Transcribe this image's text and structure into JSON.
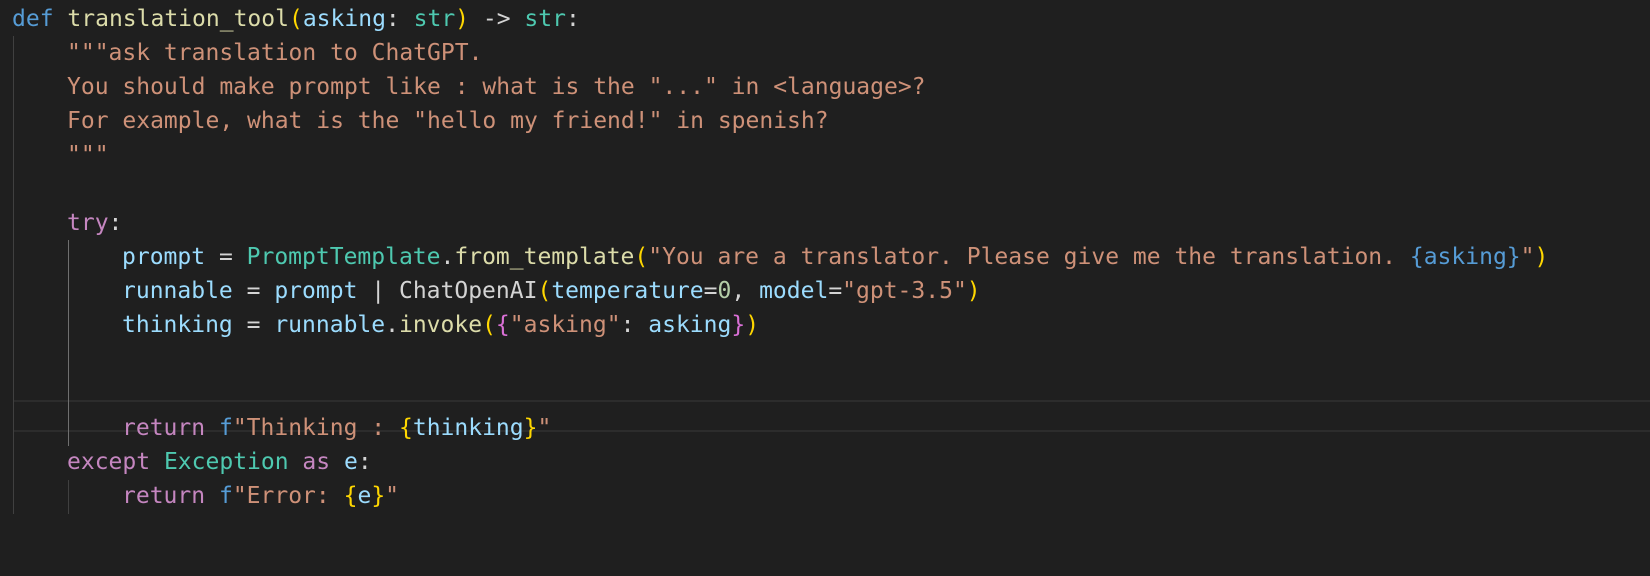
{
  "code": {
    "l1": {
      "def": "def",
      "name": "translation_tool",
      "open": "(",
      "param": "asking",
      "colon": ": ",
      "ptype": "str",
      "close": ")",
      "arrow": " -> ",
      "rtype": "str",
      "end": ":"
    },
    "l2": {
      "text": "\"\"\"ask translation to ChatGPT."
    },
    "l3": {
      "text": "You should make prompt like : what is the \"...\" in <language>?"
    },
    "l4": {
      "text": "For example, what is the \"hello my friend!\" in spenish?"
    },
    "l5": {
      "text": "\"\"\""
    },
    "l7": {
      "try": "try",
      "colon": ":"
    },
    "l8": {
      "var": "prompt",
      "eq": " = ",
      "cls": "PromptTemplate",
      "dot": ".",
      "method": "from_template",
      "open": "(",
      "str": "\"You are a translator. Please give me the translation. ",
      "interp": "{asking}",
      "strend": "\"",
      "close": ")"
    },
    "l9": {
      "var": "runnable",
      "eq": " = ",
      "var2": "prompt",
      "pipe": " | ",
      "cls": "ChatOpenAI",
      "open": "(",
      "kwarg1": "temperature",
      "eq1": "=",
      "num": "0",
      "comma": ", ",
      "kwarg2": "model",
      "eq2": "=",
      "str": "\"gpt-3.5\"",
      "close": ")"
    },
    "l10": {
      "var": "thinking",
      "eq": " = ",
      "obj": "runnable",
      "dot": ".",
      "method": "invoke",
      "open": "(",
      "brace": "{",
      "key": "\"asking\"",
      "colon": ": ",
      "val": "asking",
      "brace2": "}",
      "close": ")"
    },
    "l13": {
      "ret": "return",
      "sp": " ",
      "f": "f",
      "str": "\"Thinking : ",
      "open": "{",
      "var": "thinking",
      "close": "}",
      "strend": "\""
    },
    "l14": {
      "except": "except",
      "sp": " ",
      "cls": "Exception",
      "as": " as ",
      "var": "e",
      "colon": ":"
    },
    "l15": {
      "ret": "return",
      "sp": " ",
      "f": "f",
      "str": "\"Error: ",
      "open": "{",
      "var": "e",
      "close": "}",
      "strend": "\""
    }
  }
}
